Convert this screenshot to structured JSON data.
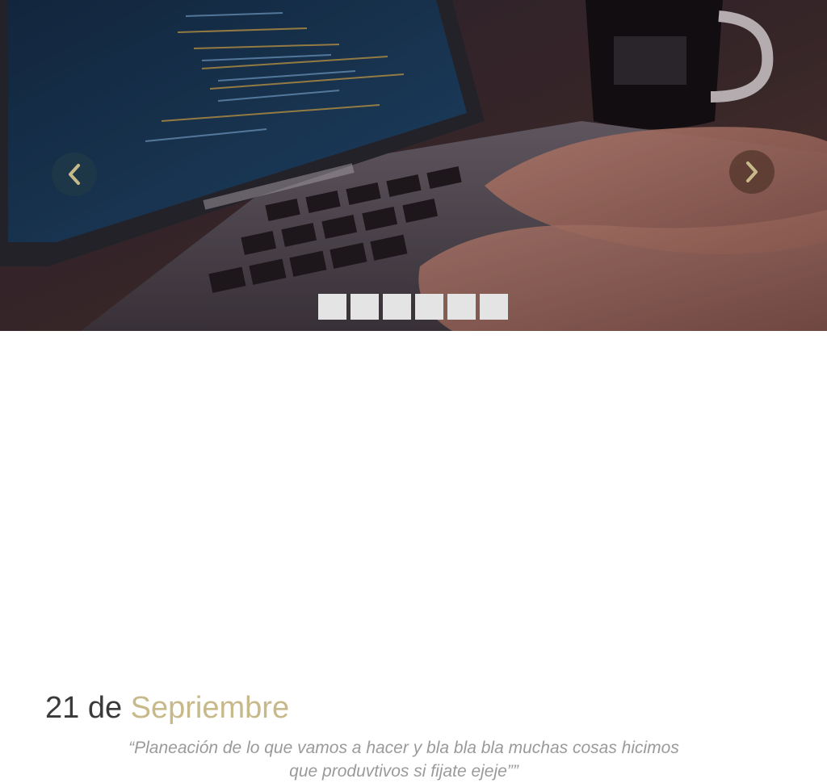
{
  "slider": {
    "prev_icon": "chevron-left-icon",
    "next_icon": "chevron-right-icon",
    "dot_count": 6
  },
  "caption": {
    "date_number": "21 de",
    "date_month": "Sepriembre",
    "quote_line1": "“Planeación de lo que vamos a hacer y bla bla bla muchas cosas hicimos",
    "quote_line2": "que produvtivos si fijate ejeje””"
  },
  "colors": {
    "accent": "#c8b98a",
    "title_text": "#3a3a3a",
    "quote_text": "#9a9a9a",
    "dot": "#e4e4e4"
  }
}
